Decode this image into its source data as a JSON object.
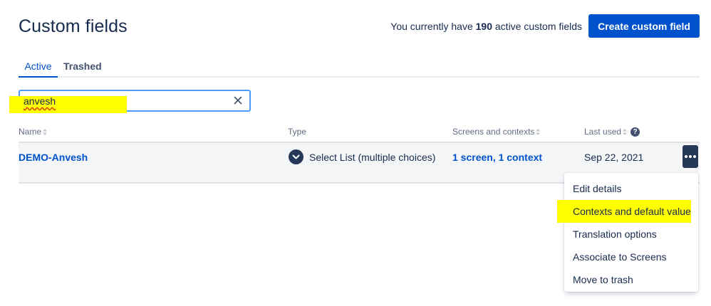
{
  "header": {
    "title": "Custom fields",
    "count_prefix": "You currently have",
    "count": "190",
    "count_suffix": "active custom fields",
    "create_button": "Create custom field"
  },
  "tabs": [
    {
      "label": "Active",
      "active": true
    },
    {
      "label": "Trashed",
      "active": false
    }
  ],
  "search": {
    "value": "anvesh"
  },
  "table": {
    "columns": [
      "Name",
      "Type",
      "Screens and contexts",
      "Last used"
    ],
    "rows": [
      {
        "name": "DEMO-Anvesh",
        "type": "Select List (multiple choices)",
        "screens": "1 screen, 1 context",
        "last_used": "Sep 22, 2021"
      }
    ]
  },
  "menu": {
    "items": [
      {
        "label": "Edit details"
      },
      {
        "label": "Contexts and default value"
      },
      {
        "label": "Translation options"
      },
      {
        "label": "Associate to Screens"
      },
      {
        "label": "Move to trash"
      }
    ]
  },
  "colors": {
    "accent": "#0052cc",
    "highlight": "#ffff00",
    "dark": "#253858"
  }
}
